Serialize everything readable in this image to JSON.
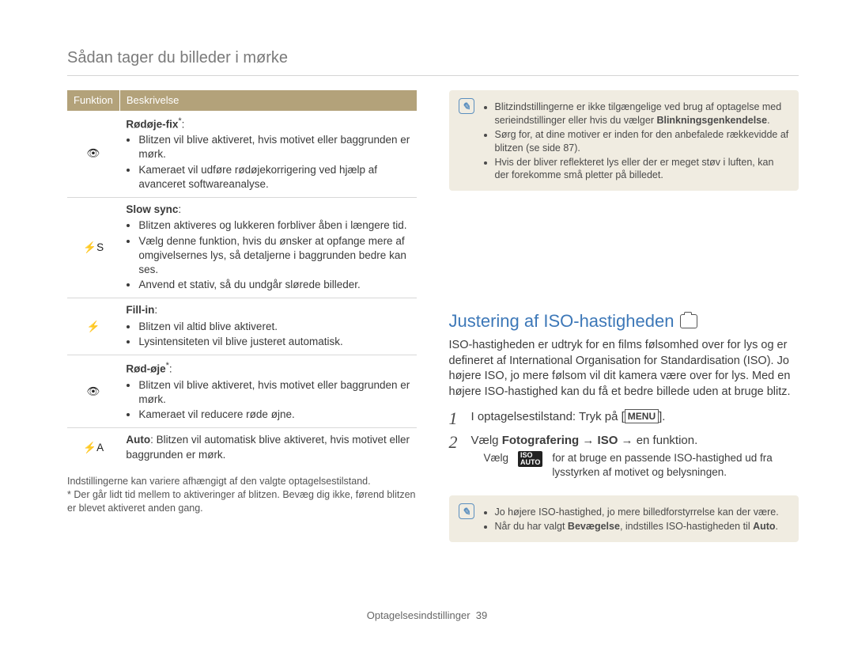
{
  "page": {
    "title": "Sådan tager du billeder i mørke",
    "footer_label": "Optagelsesindstillinger",
    "footer_page": "39"
  },
  "table": {
    "head_func": "Funktion",
    "head_desc": "Beskrivelse",
    "rows": [
      {
        "icon": "👁",
        "title": "Rødøje-fix",
        "star": "*",
        "colon": ":",
        "items": [
          "Blitzen vil blive aktiveret, hvis motivet eller baggrunden er mørk.",
          "Kameraet vil udføre rødøjekorrigering ved hjælp af avanceret softwareanalyse."
        ]
      },
      {
        "icon": "⚡S",
        "title": "Slow sync",
        "star": "",
        "colon": ":",
        "items": [
          "Blitzen aktiveres og lukkeren forbliver åben i længere tid.",
          "Vælg denne funktion, hvis du ønsker at opfange mere af omgivelsernes lys, så detaljerne i baggrunden bedre kan ses.",
          "Anvend et stativ, så du undgår slørede billeder."
        ]
      },
      {
        "icon": "⚡",
        "title": "Fill-in",
        "star": "",
        "colon": ":",
        "items": [
          "Blitzen vil altid blive aktiveret.",
          "Lysintensiteten vil blive justeret automatisk."
        ]
      },
      {
        "icon": "👁",
        "title": "Rød-øje",
        "star": "*",
        "colon": ":",
        "items": [
          "Blitzen vil blive aktiveret, hvis motivet eller baggrunden er mørk.",
          "Kameraet vil reducere røde øjne."
        ]
      },
      {
        "icon": "⚡A",
        "title_bold": "Auto",
        "plain": ": Blitzen vil automatisk blive aktiveret, hvis motivet eller baggrunden er mørk."
      }
    ],
    "footnotes": [
      "Indstillingerne kan variere afhængigt af den valgte optagelsestilstand.",
      "* Der går lidt tid mellem to aktiveringer af blitzen. Bevæg dig ikke, førend blitzen er blevet aktiveret anden gang."
    ]
  },
  "note_top": {
    "items_pre": [
      "Blitzindstillingerne er ikke tilgængelige ved brug af optagelse med serieindstillinger eller hvis du vælger "
    ],
    "bold1": "Blinkningsgenkendelse",
    "items_post1": ".",
    "item2": "Sørg for, at dine motiver er inden for den anbefalede rækkevidde af blitzen (se side 87).",
    "item3": "Hvis der bliver reflekteret lys eller der er meget støv i luften, kan der forekomme små pletter på billedet."
  },
  "section": {
    "title": "Justering af ISO-hastigheden",
    "para": "ISO-hastigheden er udtryk for en films følsomhed over for lys og er defineret af International Organisation for Standardisation (ISO). Jo højere ISO, jo mere følsom vil dit kamera være over for lys. Med en højere ISO-hastighed kan du få et bedre billede uden at bruge blitz."
  },
  "steps": {
    "s1_num": "1",
    "s1_pre": "I optagelsestilstand: Tryk på [",
    "s1_menu": "MENU",
    "s1_post": "].",
    "s2_num": "2",
    "s2_pre": "Vælg ",
    "s2_bold1": "Fotografering",
    "s2_arrow1": " → ",
    "s2_bold2": "ISO",
    "s2_arrow2": " → en funktion.",
    "s2_bullet_pre": "Vælg ",
    "s2_iso_chip_top": "ISO",
    "s2_iso_chip_bottom": "AUTO",
    "s2_bullet_post": " for at bruge en passende ISO-hastighed ud fra lysstyrken af motivet og belysningen."
  },
  "note_bottom": {
    "item1": "Jo højere ISO-hastighed, jo mere billedforstyrrelse kan der være.",
    "item2_pre": "Når du har valgt ",
    "item2_bold1": "Bevægelse",
    "item2_mid": ", indstilles ISO-hastigheden til ",
    "item2_bold2": "Auto",
    "item2_post": "."
  }
}
